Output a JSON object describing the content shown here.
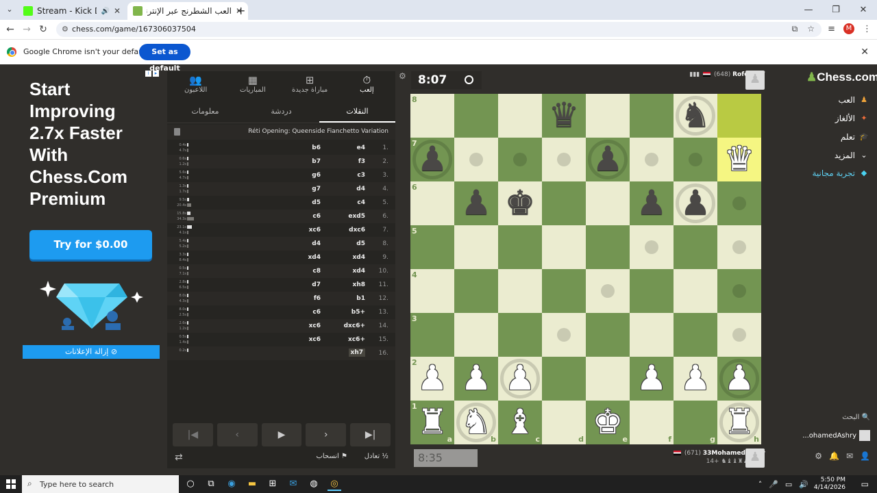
{
  "browser": {
    "tabs": [
      {
        "title": "Stream - Kick Dashboard",
        "favicon_color": "#53fc18"
      },
      {
        "title": "العب الشطرنج عبر الإنترنت مجانًا",
        "favicon_color": "#81b64c"
      }
    ],
    "url": "chess.com/game/167306037504",
    "profile_initial": "M",
    "infobar_text": "Google Chrome isn't your default browser",
    "set_default_label": "Set as default"
  },
  "ad": {
    "headline": "Start Improving 2.7x Faster With Chess.Com Premium",
    "try_label": "Try for $0.00",
    "remove_ads_label": "إزالة الإعلانات"
  },
  "panel": {
    "tabs": [
      {
        "label": "اللاعبون",
        "icon": "players-icon"
      },
      {
        "label": "المباريات",
        "icon": "games-icon"
      },
      {
        "label": "مباراة جديدة",
        "icon": "plus-icon"
      },
      {
        "label": "إلعب",
        "icon": "stopwatch-icon"
      }
    ],
    "subtabs": [
      "معلومات",
      "دردشة",
      "النقلات"
    ],
    "opening": "Réti Opening: Queenside Fianchetto Variation",
    "moves": [
      {
        "no": "1.",
        "w": "e4",
        "b": "b6",
        "tw": "0.4s",
        "tb": "4.7s",
        "bw": 0.4,
        "bb": 4.7
      },
      {
        "no": "2.",
        "w": "f3",
        "b": "b7",
        "tw": "0.6s",
        "tb": "1.2s",
        "bw": 0.6,
        "bb": 1.2
      },
      {
        "no": "3.",
        "w": "c3",
        "b": "g6",
        "tw": "5.6s",
        "tb": "4.7s",
        "bw": 5.6,
        "bb": 4.7
      },
      {
        "no": "4.",
        "w": "d4",
        "b": "g7",
        "tw": "1.3s",
        "tb": "1.7s",
        "bw": 1.3,
        "bb": 1.7
      },
      {
        "no": "5.",
        "w": "c4",
        "b": "d5",
        "tw": "9.5s",
        "tb": "20.4s",
        "bw": 9.5,
        "bb": 20.4
      },
      {
        "no": "6.",
        "w": "exd5",
        "b": "c6",
        "tw": "15.8s",
        "tb": "34.3s",
        "bw": 15.8,
        "bb": 34.3
      },
      {
        "no": "7.",
        "w": "dxc6",
        "b": "xc6",
        "tw": "23.1s",
        "tb": "4.1s",
        "bw": 23.1,
        "bb": 4.1
      },
      {
        "no": "8.",
        "w": "d5",
        "b": "d4",
        "tw": "5.4s",
        "tb": "5.2s",
        "bw": 5.4,
        "bb": 5.2
      },
      {
        "no": "9.",
        "w": "xd4",
        "b": "xd4",
        "tw": "3.3s",
        "tb": "8.4s",
        "bw": 3.3,
        "bb": 8.4
      },
      {
        "no": "10.",
        "w": "xd4",
        "b": "c8",
        "tw": "0.5s",
        "tb": "7.1s",
        "bw": 0.5,
        "bb": 7.1
      },
      {
        "no": "11.",
        "w": "xh8",
        "b": "d7",
        "tw": "2.8s",
        "tb": "6.5s",
        "bw": 2.8,
        "bb": 6.5
      },
      {
        "no": "12.",
        "w": "b1",
        "b": "f6",
        "tw": "8.0s",
        "tb": "4.3s",
        "bw": 8.0,
        "bb": 4.3
      },
      {
        "no": "13.",
        "w": "b5+",
        "b": "c6",
        "tw": "8.0s",
        "tb": "2.5s",
        "bw": 8.0,
        "bb": 2.5
      },
      {
        "no": "14.",
        "w": "dxc6+",
        "b": "xc6",
        "tw": "2.6s",
        "tb": "1.2s",
        "bw": 2.6,
        "bb": 1.2
      },
      {
        "no": "15.",
        "w": "xc6+",
        "b": "xc6",
        "tw": "0.5s",
        "tb": "1.4s",
        "bw": 0.5,
        "bb": 1.4
      },
      {
        "no": "16.",
        "w": "xh7",
        "b": "",
        "tw": "0.2s",
        "tb": "",
        "bw": 0.2,
        "bb": 0
      }
    ],
    "draw_label": "تعادل",
    "resign_label": "انسحاب"
  },
  "game": {
    "top_clock": "8:07",
    "bottom_clock": "8:35",
    "top_player": {
      "name": "Rofek017",
      "rating": "(648)",
      "captured": "♝♝♜"
    },
    "bottom_player": {
      "name": "33MohamedAshry",
      "rating": "(671)",
      "captured": "14+ ♞♝♝♜♟♟♟♟"
    },
    "files": [
      "a",
      "b",
      "c",
      "d",
      "e",
      "f",
      "g",
      "h"
    ],
    "ranks": [
      "8",
      "7",
      "6",
      "5",
      "4",
      "3",
      "2",
      "1"
    ],
    "position": [
      [
        "",
        "",
        "",
        "bq",
        "",
        "",
        "bn",
        ""
      ],
      [
        "bp",
        "",
        "",
        "",
        "bp",
        "",
        "",
        "wq"
      ],
      [
        "",
        "bp",
        "bk",
        "",
        "",
        "bp",
        "bp",
        ""
      ],
      [
        "",
        "",
        "",
        "",
        "",
        "",
        "",
        ""
      ],
      [
        "",
        "",
        "",
        "",
        "",
        "",
        "",
        ""
      ],
      [
        "",
        "",
        "",
        "",
        "",
        "",
        "",
        ""
      ],
      [
        "wp",
        "wp",
        "wp",
        "",
        "",
        "wp",
        "wp",
        "wp"
      ],
      [
        "wr",
        "wn",
        "wb",
        "",
        "wk",
        "",
        "",
        "wr"
      ]
    ],
    "highlights": [
      "h8",
      "h7"
    ],
    "dots": [
      "b7",
      "c7",
      "d7",
      "f7",
      "g7",
      "h6",
      "f5",
      "h5",
      "e4",
      "h4",
      "d3",
      "h3"
    ],
    "rings": [
      "a7",
      "e7",
      "g8",
      "g6",
      "c2",
      "h2",
      "b1",
      "h1"
    ]
  },
  "nav": {
    "logo": "Chess.com",
    "items": [
      {
        "label": "العب",
        "icon": "play-icon",
        "color": "#f0a43a"
      },
      {
        "label": "الألغاز",
        "icon": "puzzle-icon",
        "color": "#f06d3a"
      },
      {
        "label": "تعلم",
        "icon": "learn-icon",
        "color": "#3a9bf0"
      },
      {
        "label": "المزيد",
        "icon": "chevron-down-icon",
        "color": ""
      },
      {
        "label": "تجربة مجانية",
        "icon": "diamond-icon",
        "color": "#4ad2f0"
      }
    ],
    "search_label": "البحث",
    "username": "...ohamedAshry"
  },
  "taskbar": {
    "search_placeholder": "Type here to search",
    "time": "5:50 PM",
    "date": "4/14/2026"
  }
}
